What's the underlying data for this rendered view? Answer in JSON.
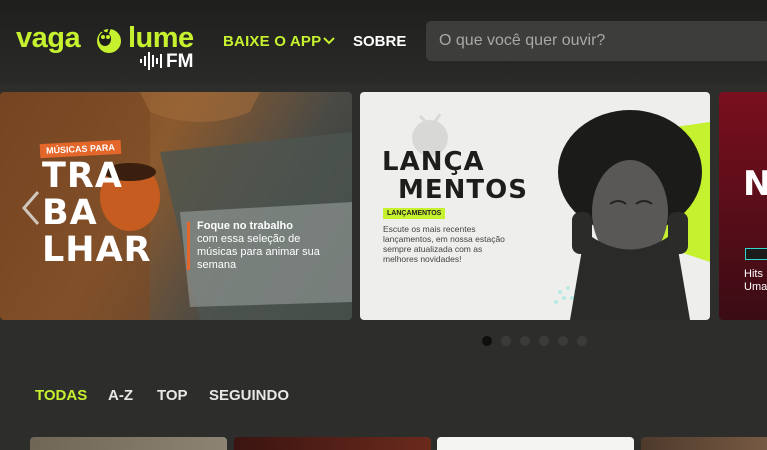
{
  "header": {
    "logo": {
      "text_left": "vaga",
      "text_right": "lume",
      "suffix": "FM"
    },
    "nav": {
      "app_label": "BAIXE O APP",
      "about_label": "SOBRE"
    },
    "search": {
      "placeholder": "O que você quer ouvir?"
    }
  },
  "carousel": {
    "slides": [
      {
        "tag": "MÚSICAS PARA",
        "title_lines": [
          "TRA",
          "BA",
          "LHAR"
        ],
        "desc_strong": "Foque no trabalho",
        "desc": "com essa seleção de músicas para animar sua semana"
      },
      {
        "title_lines": [
          "LANÇA",
          "MENTOS"
        ],
        "tag": "LANÇAMENTOS",
        "desc": "Escute os mais recentes lançamentos, em nossa estação sempre atualizada com as melhores novidades!"
      },
      {
        "title_partial": "NO",
        "badge": "N",
        "desc_partial": "Hits\nUma"
      }
    ],
    "dots_count": 6,
    "active_dot": 0
  },
  "tabs": [
    {
      "label": "TODAS",
      "active": true
    },
    {
      "label": "A-Z",
      "active": false
    },
    {
      "label": "TOP",
      "active": false
    },
    {
      "label": "SEGUINDO",
      "active": false
    }
  ],
  "colors": {
    "accent": "#c6f12e",
    "background": "#2d2d2b",
    "orange": "#e3662a"
  }
}
